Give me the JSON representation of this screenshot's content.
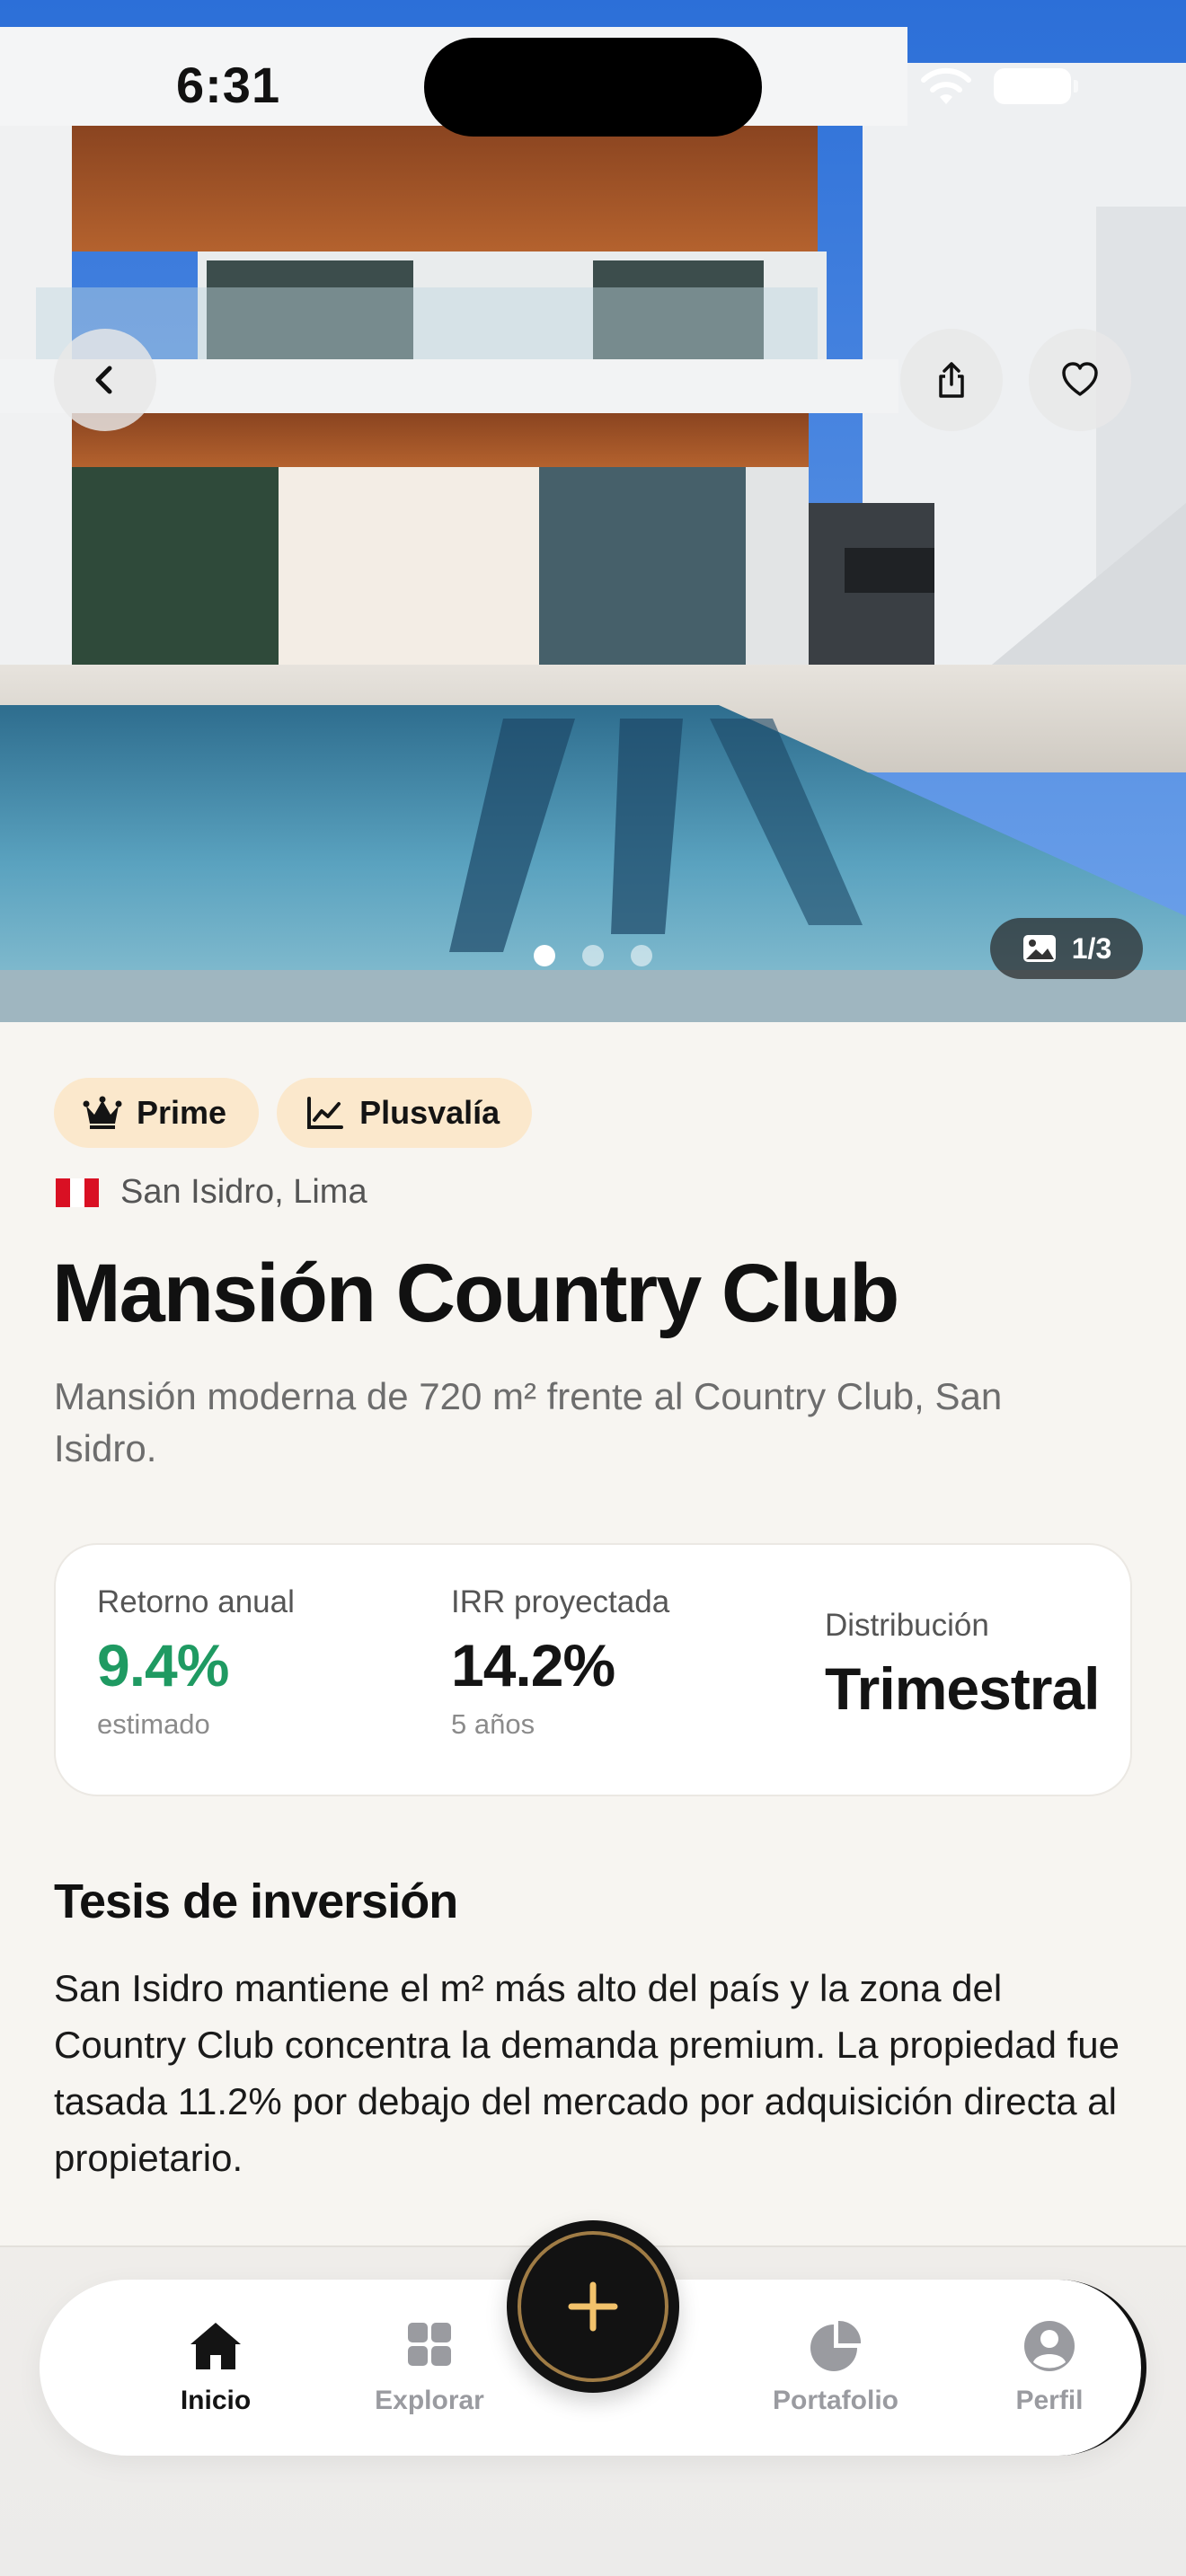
{
  "status_bar": {
    "time": "6:31"
  },
  "gallery": {
    "counter": "1/3",
    "total_dots": 3,
    "active_dot": 1
  },
  "tags": [
    {
      "label": "Prime",
      "icon": "crown-icon"
    },
    {
      "label": "Plusvalía",
      "icon": "trend-chart-icon"
    }
  ],
  "location": {
    "text": "San Isidro, Lima",
    "flag": "peru-flag"
  },
  "property": {
    "title": "Mansión Country Club",
    "subtitle": "Mansión moderna de 720 m² frente al Country Club, San Isidro."
  },
  "stats": {
    "annual_return": {
      "label": "Retorno anual",
      "value": "9.4%",
      "note": "estimado"
    },
    "irr": {
      "label": "IRR proyectada",
      "value": "14.2%",
      "note": "5 años"
    },
    "distribution": {
      "label": "Distribución",
      "value": "Trimestral"
    }
  },
  "thesis": {
    "title": "Tesis de inversión",
    "text": "San Isidro mantiene el m² más alto del país y la zona del Country Club concentra la demanda premium. La propiedad fue tasada 11.2% por debajo del mercado por adquisición directa al propietario."
  },
  "tabbar": {
    "home": "Inicio",
    "explore": "Explorar",
    "portfolio": "Portafolio",
    "profile": "Perfil"
  },
  "colors": {
    "accent_green": "#1f9a62",
    "chip_bg": "#fbe8cc",
    "fab_ring": "#a07c45",
    "fab_plus": "#f2c26b"
  }
}
